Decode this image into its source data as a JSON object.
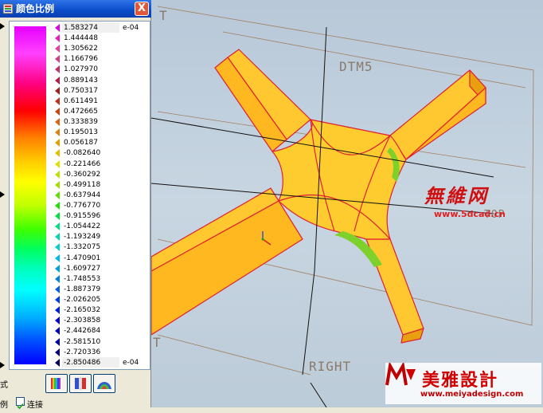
{
  "dialog": {
    "title": "颜色比例",
    "close_label": "X"
  },
  "scale": {
    "exponent_top": "e-04",
    "exponent_bottom": "e-04",
    "values": [
      "1.583274",
      "1.444448",
      "1.305622",
      "1.166796",
      "1.027970",
      "0.889143",
      "0.750317",
      "0.611491",
      "0.472665",
      "0.333839",
      "0.195013",
      "0.056187",
      "-0.082640",
      "-0.221466",
      "-0.360292",
      "-0.499118",
      "-0.637944",
      "-0.776770",
      "-0.915596",
      "-1.054422",
      "-1.193249",
      "-1.332075",
      "-1.470901",
      "-1.609727",
      "-1.748553",
      "-1.887379",
      "-2.026205",
      "-2.165032",
      "-2.303858",
      "-2.442684",
      "-2.581510",
      "-2.720336",
      "-2.850486"
    ],
    "arrow_colors": [
      "#e000e0",
      "#e020c0",
      "#e040a0",
      "#d04080",
      "#c03060",
      "#b02040",
      "#a02020",
      "#c03020",
      "#d04010",
      "#e06010",
      "#e08010",
      "#e0a000",
      "#e0c000",
      "#e0e000",
      "#c0e000",
      "#a0e000",
      "#60e000",
      "#20e000",
      "#00e040",
      "#00e080",
      "#00d8b0",
      "#00d0d0",
      "#00c0e0",
      "#00a0e0",
      "#0080e0",
      "#0060e0",
      "#0040e0",
      "#0020e0",
      "#0000e0",
      "#0000c0",
      "#0000a0",
      "#000080",
      "#000060"
    ]
  },
  "controls": {
    "mode_label": "式",
    "ratio_label": "例",
    "link_label": "连接",
    "link_checked": "✓"
  },
  "viewport": {
    "datum_dtm5": "DTM5",
    "datum_right": "RIGHT",
    "datum_top": "T",
    "datum_top2": "T",
    "datum_top3": "TOP"
  },
  "watermarks": {
    "site1_name": "無維网",
    "site1_url": "www.5dcad.cn",
    "site2_name": "美雅設計",
    "site2_url": "www.meiyadesign.com"
  }
}
